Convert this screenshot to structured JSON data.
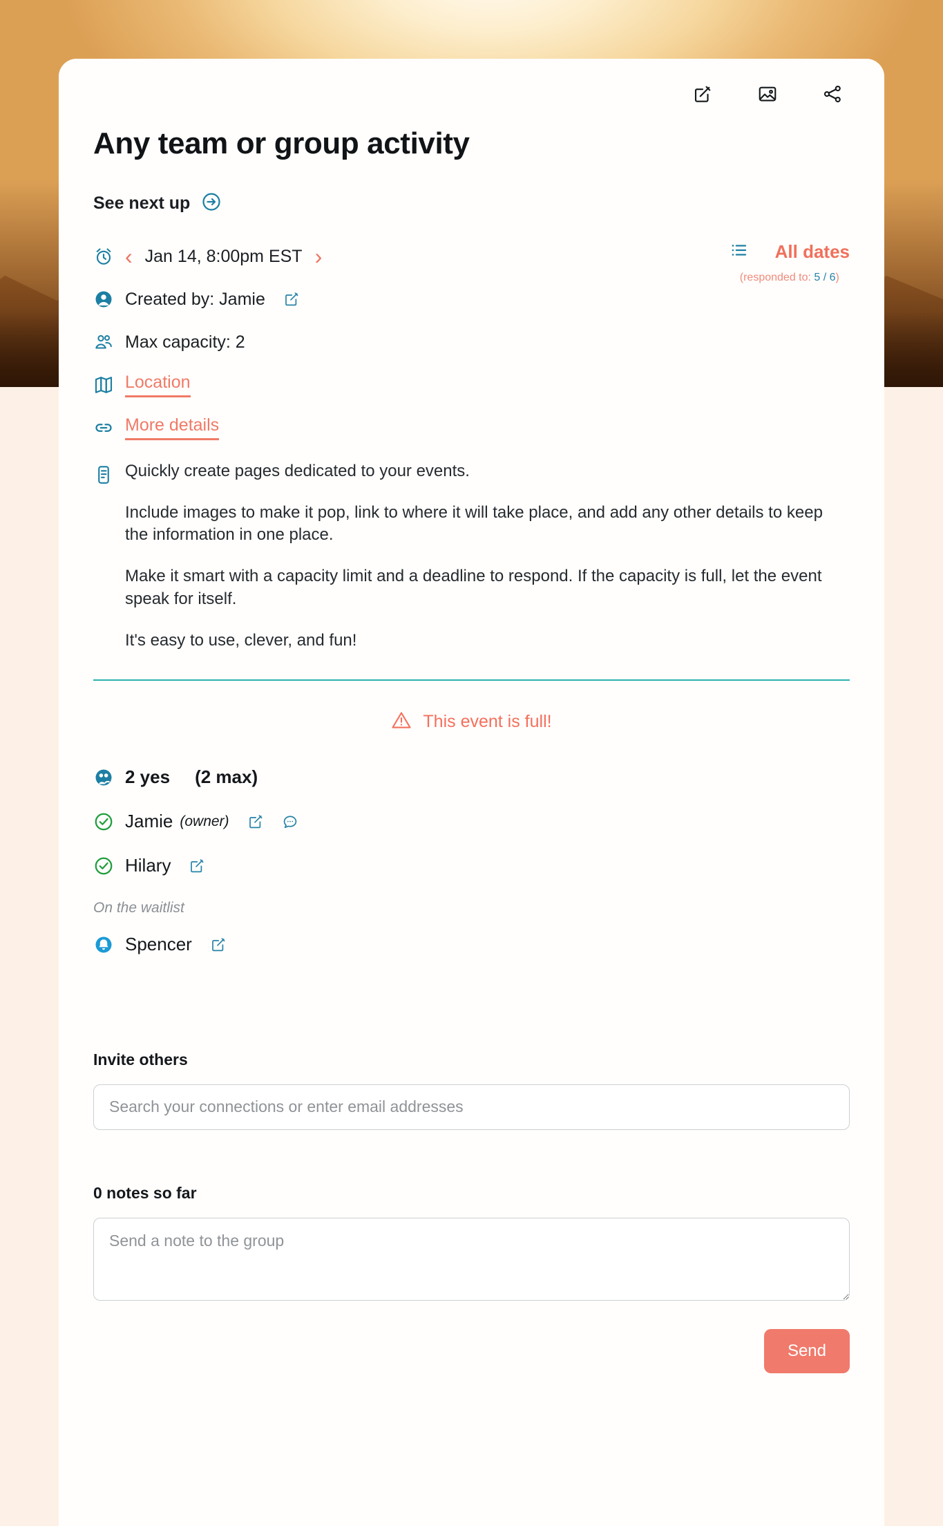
{
  "theme": {
    "coral": "#f07a67",
    "teal": "#2682a8",
    "divider": "#2bb3ad",
    "green": "#1f9d3d",
    "card_bg": "#fffefc",
    "page_bg": "#fdf1e7"
  },
  "header": {
    "actions": [
      {
        "name": "edit-icon",
        "label": "Edit"
      },
      {
        "name": "image-icon",
        "label": "Change image"
      },
      {
        "name": "share-icon",
        "label": "Share"
      }
    ],
    "title": "Any team or group activity"
  },
  "next_up": {
    "label": "See next up",
    "arrow_icon": "arrow-right-circle-icon"
  },
  "meta": {
    "date": {
      "icon": "alarm-clock-icon",
      "prev": "‹",
      "value": "Jan 14, 8:00pm EST",
      "next": "›"
    },
    "created_by": {
      "icon": "person-icon",
      "value": "Created by: Jamie",
      "edit_icon": "edit-square-icon"
    },
    "capacity": {
      "icon": "people-icon",
      "value": "Max capacity: 2"
    },
    "location": {
      "icon": "map-icon",
      "label": "Location"
    },
    "more_details": {
      "icon": "link-icon",
      "label": "More details"
    }
  },
  "all_dates": {
    "list_icon": "list-icon",
    "label": "All dates",
    "responded_prefix": "(responded to: ",
    "responded_value": "5 / 6",
    "responded_suffix": ")"
  },
  "description": {
    "icon": "notes-icon",
    "paragraphs": [
      "Quickly create pages dedicated to your events.",
      "Include images to make it pop, link to where it will take place, and add any other details to keep the information in one place.",
      "Make it smart with a capacity limit and a deadline to respond. If the capacity is full, let the event speak for itself.",
      "It's easy to use, clever, and fun!"
    ]
  },
  "full_banner": {
    "icon": "warning-triangle-icon",
    "text": "This event is full!"
  },
  "attendees": {
    "summary_icon": "attendees-icon",
    "yes_count": "2 yes",
    "max_count": "(2 max)",
    "confirmed": [
      {
        "status_icon": "check-circle-icon",
        "name": "Jamie",
        "role": "(owner)",
        "actions": [
          "edit-square-icon",
          "comment-icon"
        ]
      },
      {
        "status_icon": "check-circle-icon",
        "name": "Hilary",
        "role": "",
        "actions": [
          "edit-square-icon"
        ]
      }
    ],
    "waitlist_label": "On the waitlist",
    "waitlist": [
      {
        "status_icon": "bell-icon",
        "name": "Spencer",
        "actions": [
          "edit-square-icon"
        ]
      }
    ]
  },
  "invite": {
    "title": "Invite others",
    "placeholder": "Search your connections or enter email addresses",
    "value": ""
  },
  "notes": {
    "title": "0 notes so far",
    "placeholder": "Send a note to the group",
    "value": "",
    "send_label": "Send"
  }
}
